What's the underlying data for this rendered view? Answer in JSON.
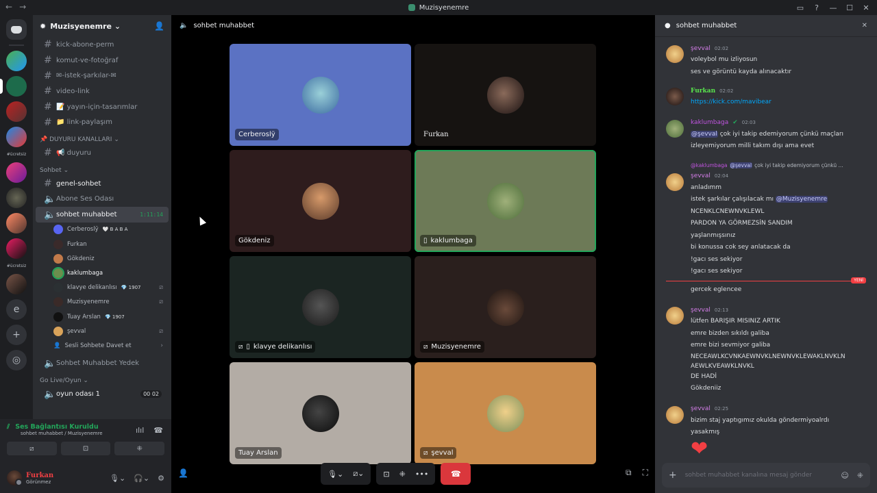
{
  "window": {
    "title": "Muzisyenemre",
    "back": "←",
    "forward": "→",
    "btn_inbox": "▭",
    "btn_help": "?",
    "btn_min": "—",
    "btn_max": "☐",
    "btn_close": "✕"
  },
  "guild_labels": {
    "label1": "#ücretsiz",
    "label2": "#ücretsiz",
    "letter_e": "e"
  },
  "server": {
    "name": "Muzisyenemre ⌄"
  },
  "channels": {
    "c1": "kick-abone-perm",
    "c2": "komut-ve-fotoğraf",
    "c3": "✉-istek-şarkılar-✉",
    "c4": "video-link",
    "c5": "📝 yayın-için-tasarımlar",
    "c6": "📁 link-paylaşım",
    "cat_duyuru": "📌 DUYURU KANALLARI ⌄",
    "duyuru": "📢 duyuru",
    "cat_sohbet": "Sohbet ⌄",
    "genel": "genel-sohbet",
    "abone": "Abone Ses Odası",
    "active": "sohbet muhabbet",
    "active_timer": "1:11:14",
    "yedek": "Sohbet Muhabbet Yedek",
    "cat_golive": "Go Live/Oyun ⌄",
    "oyun": "oyun odası 1",
    "oyun_count": "00 02",
    "invite": "Sesli Sohbete Davet et"
  },
  "voice_users": {
    "u1": "Cerberoslÿ",
    "u1_tag": "🤍 B A B A",
    "u2": "Furkan",
    "u3": "Gökdeniz",
    "u4": "kaklumbaga",
    "u5": "klavye delikanlısı",
    "u5_tag": "💎 1907",
    "u6": "Muzisyenemre",
    "u7": "Tuay Arslan",
    "u7_tag": "💎 1907",
    "u8": "şevval"
  },
  "voice_panel": {
    "status": "Ses Bağlantısı Kuruldu",
    "sub": "sohbet muhabbet / Muzisyenemre"
  },
  "user": {
    "name": "Furkan",
    "status": "Görünmez"
  },
  "stage": {
    "channel": "sohbet muhabbet"
  },
  "tiles": {
    "t1": "Cerberoslÿ",
    "t2": "Furkan",
    "t3": "Gökdeniz",
    "t4": "kaklumbaga",
    "t5": "klavye delikanlısı",
    "t6": "Muzisyenemre",
    "t7": "Tuay Arslan",
    "t8": "şevval"
  },
  "chat": {
    "header": "sohbet muhabbet",
    "input_placeholder": "sohbet muhabbet kanalına mesaj gönder",
    "new_badge": "YENİ",
    "m1": {
      "author": "şevval",
      "time": "02:02",
      "l1": "voleybol mu izliyosun",
      "l2": "ses ve görüntü kayda alınacaktır"
    },
    "m2": {
      "author": "Furkan",
      "time": "02:02",
      "l1": "https://kick.com/mavibear"
    },
    "m3": {
      "author": "kaklumbaga",
      "time": "02:03",
      "mention": "@şevval",
      "l1": " çok iyi takip edemiyorum çünkü maçları",
      "l2": "izleyemiyorum milli takım dışı ama evet"
    },
    "m4": {
      "reply_user": "@kaklumbaga",
      "reply_mention": "@şevval",
      "reply_text": "çok iyi takip edemiyorum çünkü ...",
      "author": "şevval",
      "time": "02:04",
      "l1": "anladımm",
      "l2": "istek şarkılar çalışılacak mı ",
      "l2_mention": "@Muzisyenemre",
      "l3": "NCENKLCNEWNVKLEWL",
      "l4": "PARDON YA GÖRMEZSİN SANDIM",
      "l5": "yaşlanmışsınız",
      "l6": "bi konussa cok sey anlatacak da",
      "l7": "!gacı ses sekiyor",
      "l8": "!gacı ses sekiyor",
      "l9": "gercek eglencee"
    },
    "m5": {
      "author": "şevval",
      "time": "02:13",
      "l1": "lütfen BARIŞIR MISINIZ ARTIK",
      "l2": "emre bizden sıkıldı galiba",
      "l3": "emre bizi sevmiyor galiba",
      "l4": "NECEAWLKCVNKAEWNVKLNEWNVKLEWAKLNVKLN",
      "l5": "AEWLKVEAWKLNVKL",
      "l6": "DE HADİ",
      "l7": "Gökdeniiz"
    },
    "m6": {
      "author": "şevval",
      "time": "02:25",
      "l1": "bizim staj yaptıgımız okulda göndermiyoalrdı",
      "l2": "yasakmış",
      "heart": "❤"
    }
  },
  "colors": {
    "accent_green": "#23a55a",
    "hangup_red": "#da373c",
    "link": "#00a8fc",
    "sevval": "#d47ee8",
    "furkan": "#59e84d",
    "kaklumbaga": "#c154e0"
  }
}
